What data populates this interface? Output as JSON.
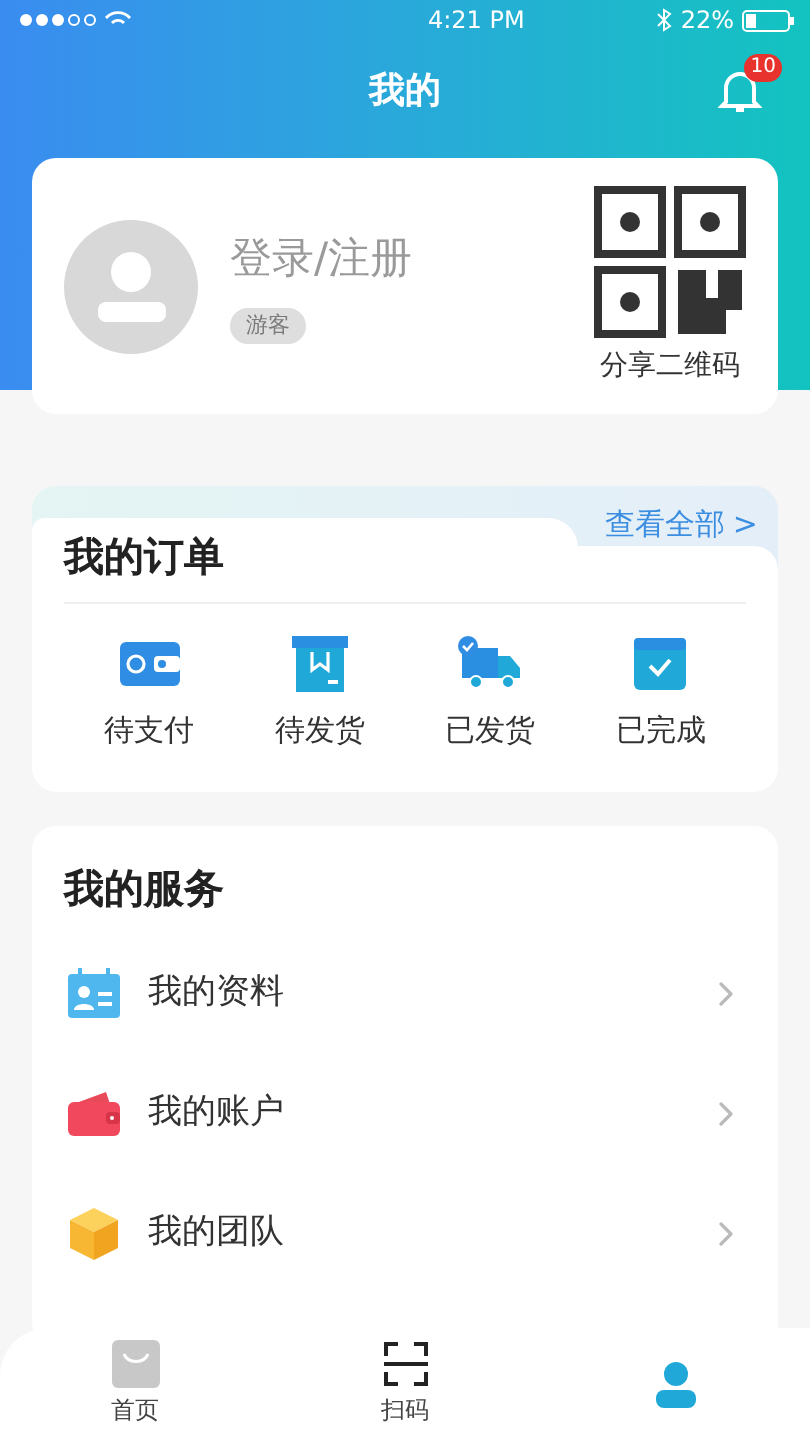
{
  "status_bar": {
    "time": "4:21 PM",
    "battery": "22%"
  },
  "header": {
    "title": "我的",
    "notification_count": "10"
  },
  "profile": {
    "login": "登录/注册",
    "badge": "游客",
    "qr_label": "分享二维码"
  },
  "orders": {
    "title": "我的订单",
    "view_all": "查看全部",
    "chevron": ">",
    "items": [
      {
        "kind": "wallet",
        "label": "待支付"
      },
      {
        "kind": "box",
        "label": "待发货"
      },
      {
        "kind": "truck",
        "label": "已发货"
      },
      {
        "kind": "done",
        "label": "已完成"
      }
    ]
  },
  "services": {
    "title": "我的服务",
    "items": [
      {
        "kind": "profile",
        "label": "我的资料"
      },
      {
        "kind": "account",
        "label": "我的账户"
      },
      {
        "kind": "team",
        "label": "我的团队"
      }
    ]
  },
  "tab_bar": [
    {
      "kind": "home",
      "label": "首页",
      "selected": false
    },
    {
      "kind": "scan",
      "label": "扫码",
      "selected": false
    },
    {
      "kind": "me",
      "selected": true
    }
  ]
}
